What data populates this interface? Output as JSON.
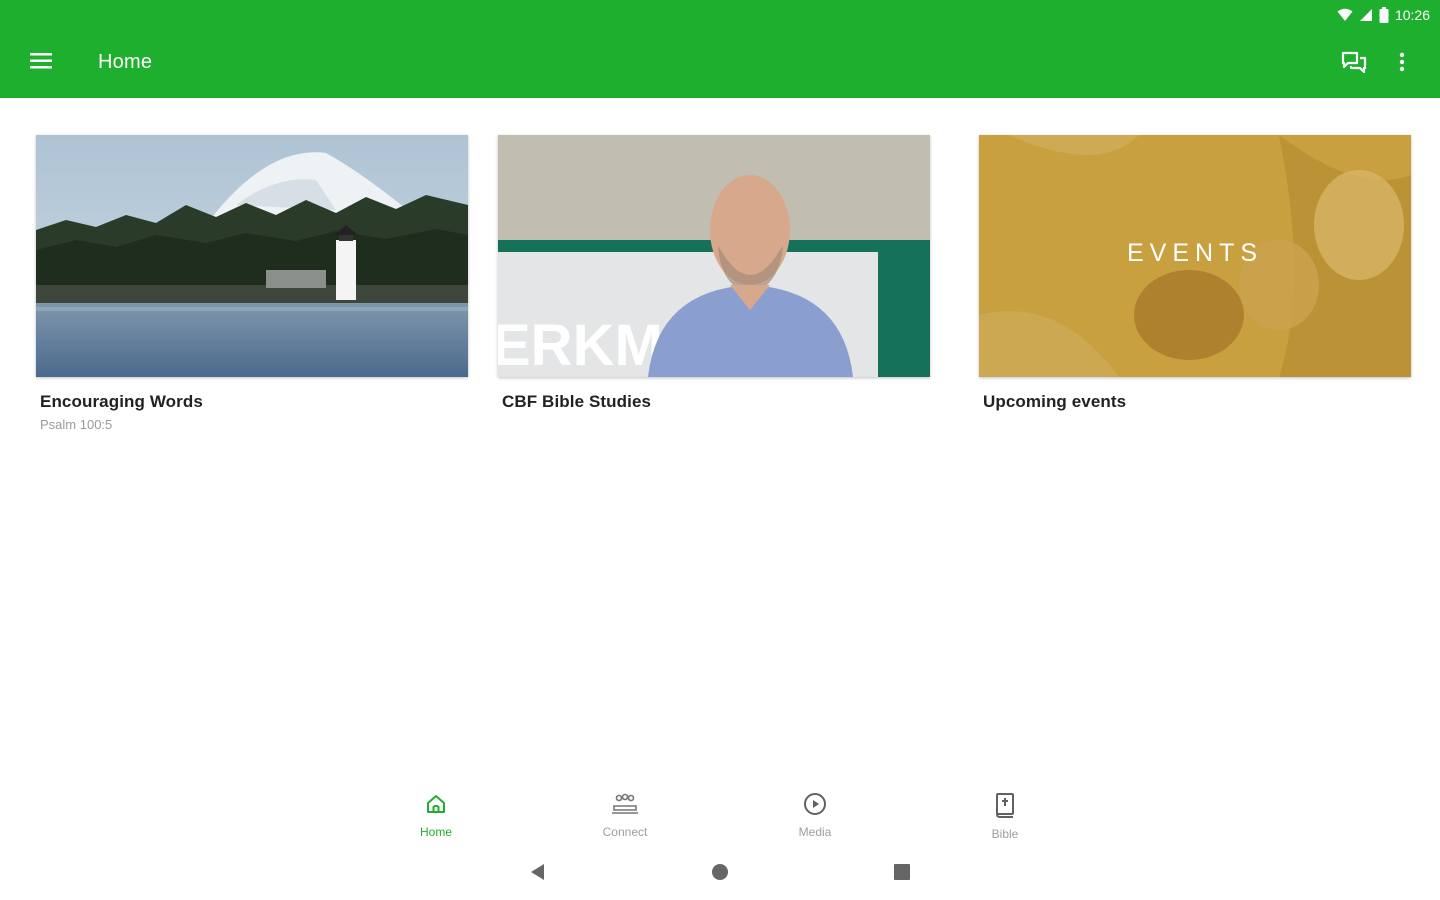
{
  "status_bar": {
    "time": "10:26"
  },
  "app_bar": {
    "title": "Home",
    "background_color": "#1faf2e",
    "icons": [
      "menu-icon",
      "chat-icon",
      "more-vert-icon"
    ]
  },
  "cards": [
    {
      "title": "Encouraging Words",
      "subtitle": "Psalm 100:5",
      "image": "lighthouse-mountain-lake"
    },
    {
      "title": "CBF Bible Studies",
      "subtitle": "",
      "image": "smiling-man-portrait",
      "image_text": "ERKM"
    },
    {
      "title": "Upcoming events",
      "subtitle": "",
      "image": "events-banner",
      "image_text": "EVENTS"
    }
  ],
  "bottom_nav": {
    "items": [
      {
        "label": "Home",
        "icon": "home-icon",
        "active": true
      },
      {
        "label": "Connect",
        "icon": "connect-icon",
        "active": false
      },
      {
        "label": "Media",
        "icon": "play-circle-icon",
        "active": false
      },
      {
        "label": "Bible",
        "icon": "bible-icon",
        "active": false
      }
    ],
    "active_color": "#1faf2e",
    "inactive_color": "#9e9e9e"
  },
  "system_nav": [
    "back-icon",
    "home-circle-icon",
    "recents-icon"
  ]
}
